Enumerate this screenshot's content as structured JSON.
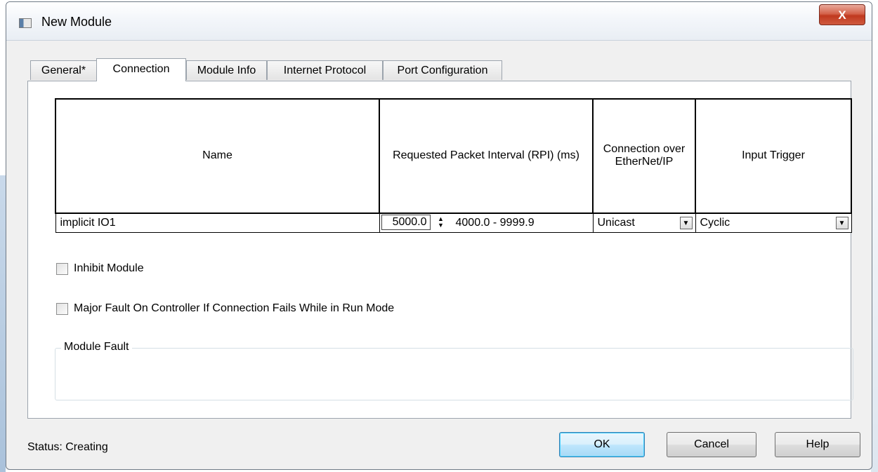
{
  "window": {
    "title": "New Module",
    "close_glyph": "X"
  },
  "tabs": [
    {
      "label": "General*",
      "active": false
    },
    {
      "label": "Connection",
      "active": true
    },
    {
      "label": "Module Info",
      "active": false
    },
    {
      "label": "Internet Protocol",
      "active": false
    },
    {
      "label": "Port Configuration",
      "active": false
    }
  ],
  "connection_table": {
    "headers": {
      "name": "Name",
      "rpi": "Requested Packet Interval (RPI) (ms)",
      "connection": "Connection over EtherNet/IP",
      "trigger": "Input Trigger"
    },
    "row": {
      "name": "implicit IO1",
      "rpi_value": "5000.0",
      "rpi_range": "4000.0 - 9999.9",
      "connection": "Unicast",
      "trigger": "Cyclic"
    }
  },
  "options": {
    "inhibit": {
      "label": "Inhibit Module",
      "checked": false
    },
    "major_fault": {
      "label": "Major Fault On Controller If Connection Fails While in Run Mode",
      "checked": false
    }
  },
  "module_fault": {
    "legend": "Module Fault"
  },
  "status": {
    "text": "Status:  Creating"
  },
  "buttons": {
    "ok": "OK",
    "cancel": "Cancel",
    "help": "Help"
  },
  "colors": {
    "accent": "#3c7fb1",
    "close": "#c0391f"
  },
  "icons": {
    "spin": "spinner-arrows-icon",
    "dropdown": "dropdown-arrow-icon",
    "window": "window-icon"
  }
}
